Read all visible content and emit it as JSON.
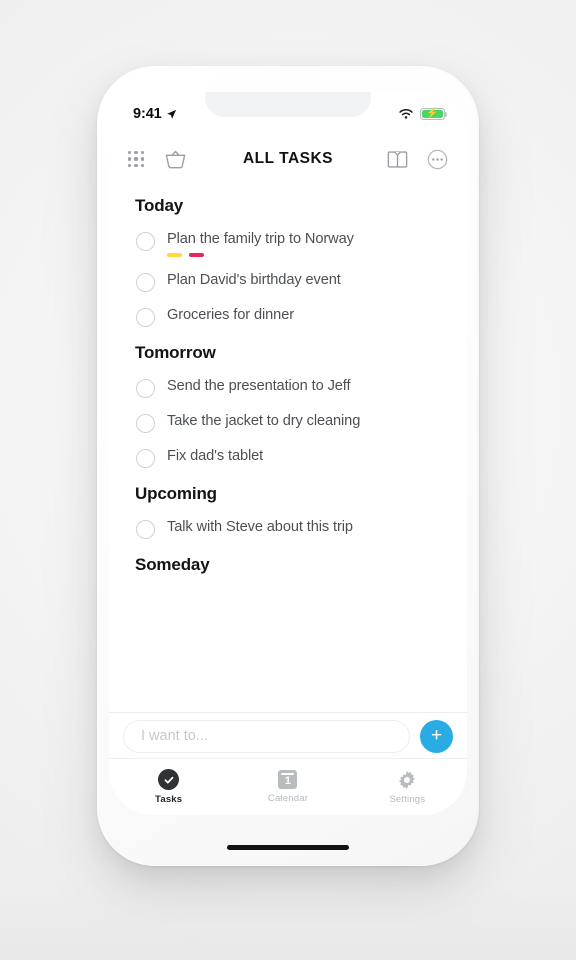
{
  "status_bar": {
    "time": "9:41",
    "location_icon": "location-arrow-icon",
    "wifi_icon": "wifi-icon",
    "battery_icon": "battery-charging-icon",
    "battery_level_percent": 100,
    "battery_color": "#4ad663"
  },
  "nav_bar": {
    "title": "ALL TASKS",
    "left_icons": [
      {
        "name": "grid-menu-icon",
        "label": "Grid menu"
      },
      {
        "name": "basket-icon",
        "label": "Basket"
      }
    ],
    "right_icons": [
      {
        "name": "book-icon",
        "label": "Book"
      },
      {
        "name": "more-options-icon",
        "label": "More"
      }
    ]
  },
  "sections": [
    {
      "heading": "Today",
      "tasks": [
        {
          "text": "Plan the family trip to Norway",
          "checked": false,
          "tags": [
            "#FFD83D",
            "#E8245A"
          ]
        },
        {
          "text": "Plan David's birthday event",
          "checked": false,
          "tags": []
        },
        {
          "text": "Groceries for dinner",
          "checked": false,
          "tags": []
        }
      ]
    },
    {
      "heading": "Tomorrow",
      "tasks": [
        {
          "text": "Send the presentation to Jeff",
          "checked": false,
          "tags": []
        },
        {
          "text": "Take the jacket to dry cleaning",
          "checked": false,
          "tags": []
        },
        {
          "text": "Fix dad's tablet",
          "checked": false,
          "tags": []
        }
      ]
    },
    {
      "heading": "Upcoming",
      "tasks": [
        {
          "text": "Talk with Steve about this trip",
          "checked": false,
          "tags": []
        }
      ]
    },
    {
      "heading": "Someday",
      "tasks": []
    }
  ],
  "input_bar": {
    "placeholder": "I want to...",
    "value": "",
    "add_button_label": "+",
    "add_button_color": "#29ace4"
  },
  "tab_bar": {
    "tabs": [
      {
        "label": "Tasks",
        "icon": "check-circle-icon",
        "active": true
      },
      {
        "label": "Calendar",
        "icon": "calendar-icon",
        "icon_text": "1",
        "active": false
      },
      {
        "label": "Settings",
        "icon": "gear-icon",
        "active": false
      }
    ]
  }
}
